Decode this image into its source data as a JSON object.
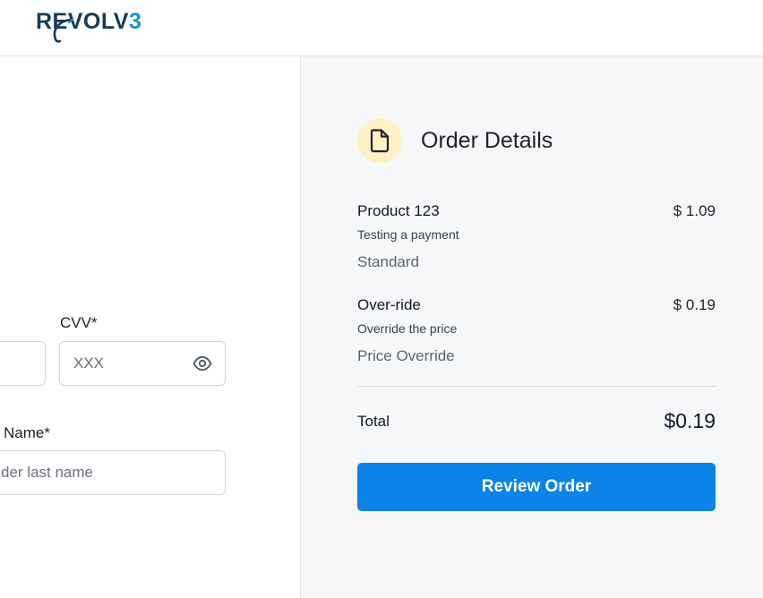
{
  "header": {
    "logo_text_main": "REVOLV",
    "logo_text_accent": "3"
  },
  "form": {
    "cvv": {
      "label": "CVV*",
      "placeholder": "XXX",
      "toggle_icon": "eye-icon"
    },
    "last_name": {
      "label": "Name*",
      "placeholder": "der last name"
    }
  },
  "order": {
    "title": "Order Details",
    "icon": "document-icon",
    "items": [
      {
        "name": "Product 123",
        "price": "$ 1.09",
        "description": "Testing a payment",
        "type": "Standard"
      },
      {
        "name": "Over-ride",
        "price": "$ 0.19",
        "description": "Override the price",
        "type": "Price Override"
      }
    ],
    "total_label": "Total",
    "total_value": "$0.19",
    "button_label": "Review Order"
  },
  "colors": {
    "accent": "#0a84e8",
    "brand_dark": "#173a5e",
    "brand_light": "#1a8fd8",
    "icon_bg": "#fdf0c5",
    "panel_bg": "#f6f7f9"
  }
}
